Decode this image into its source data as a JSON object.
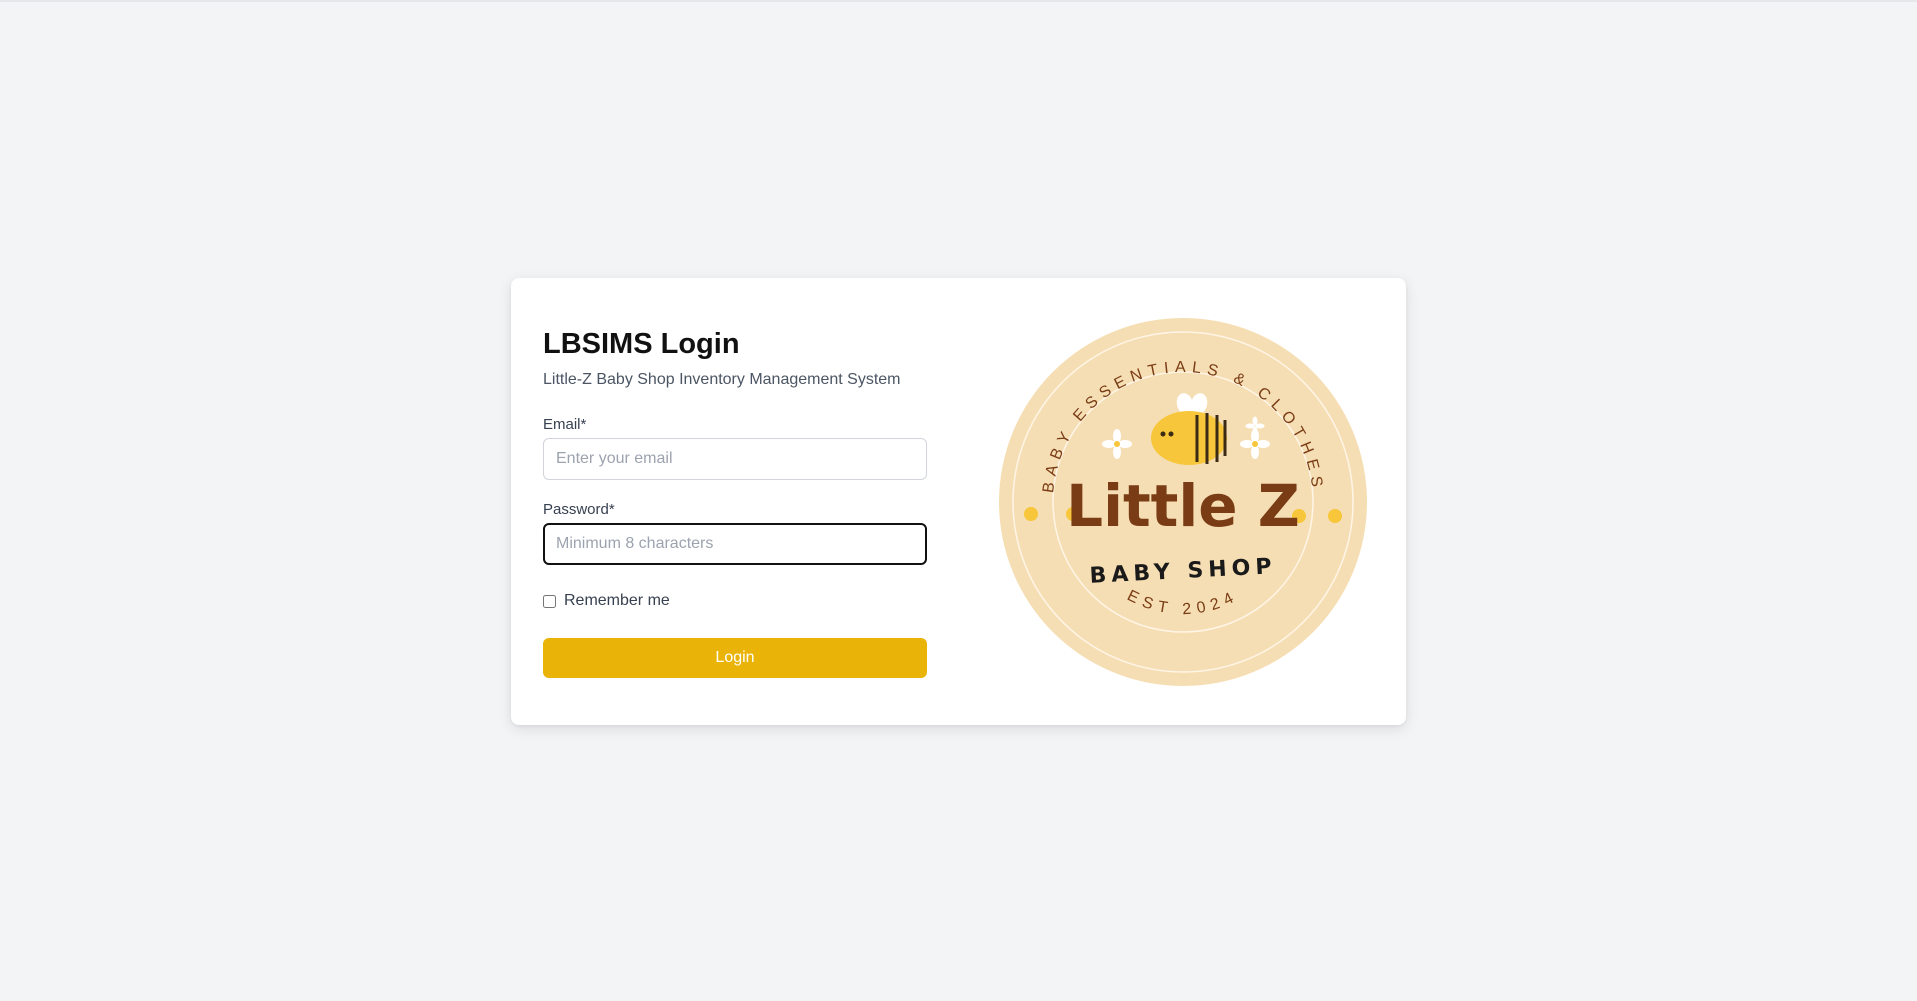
{
  "login": {
    "title": "LBSIMS Login",
    "subtitle": "Little-Z Baby Shop Inventory Management System",
    "email_label": "Email*",
    "email_placeholder": "Enter your email",
    "password_label": "Password*",
    "password_placeholder": "Minimum 8 characters",
    "remember_label": "Remember me",
    "remember_checked": false,
    "submit_label": "Login"
  },
  "logo": {
    "top_arc_text": "BABY ESSENTIALS & CLOTHES",
    "brand_name": "Little Z",
    "brand_sub": "BABY SHOP",
    "bottom_arc_text": "EST 2024",
    "icons": [
      "bee-icon",
      "daisy-icon"
    ]
  },
  "colors": {
    "page_bg": "#f3f4f6",
    "card_bg": "#ffffff",
    "accent": "#eab308",
    "logo_bg": "#f6deb4",
    "logo_brown": "#7a3c14",
    "bee_yellow": "#f7c63a"
  }
}
